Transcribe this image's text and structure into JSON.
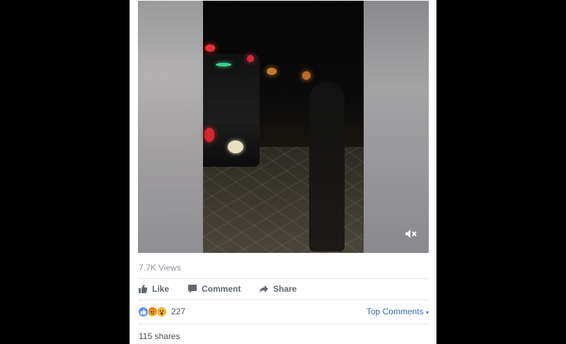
{
  "post": {
    "views": "7.7K Views",
    "actions": {
      "like": "Like",
      "comment": "Comment",
      "share": "Share"
    },
    "reaction_count": "227",
    "top_comments": "Top Comments",
    "shares": "115 shares",
    "reaction_icons": [
      "like-icon",
      "angry-icon",
      "wow-icon"
    ]
  },
  "colors": {
    "like_blue": "#5890ff",
    "angry": "#e9710f",
    "wow": "#f7b125",
    "link": "#4267b2"
  }
}
